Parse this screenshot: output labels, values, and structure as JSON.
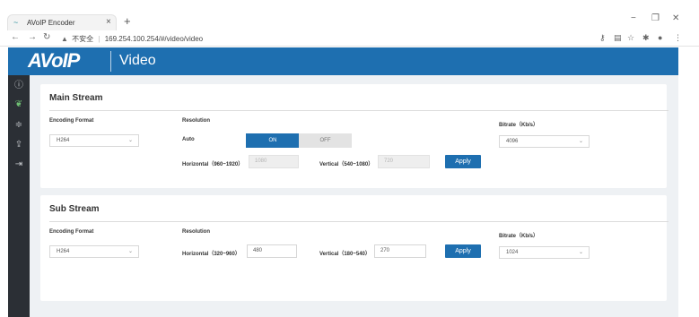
{
  "browser": {
    "tab_title": "AVoIP Encoder",
    "tab_close": "×",
    "new_tab": "+",
    "tab_icon": "~",
    "security_label": "不安全",
    "url": "169.254.100.254/#/video/video",
    "win_minimize": "−",
    "win_restore": "❐",
    "win_close": "✕"
  },
  "app": {
    "logo": "AVoIP",
    "page_title": "Video",
    "accent_color": "#1e6fb0"
  },
  "sidenav": {
    "items": [
      {
        "icon": "info-icon",
        "glyph": "ⓘ"
      },
      {
        "icon": "leaf-icon",
        "glyph": "❦",
        "active": true
      },
      {
        "icon": "sliders-icon",
        "glyph": "≑"
      },
      {
        "icon": "upload-icon",
        "glyph": "⇪"
      },
      {
        "icon": "logout-icon",
        "glyph": "⇥"
      }
    ]
  },
  "main_stream": {
    "title": "Main Stream",
    "encoding_format_label": "Encoding Format",
    "encoding_format_value": "H264",
    "resolution_label": "Resolution",
    "auto_label": "Auto",
    "toggle_on": "ON",
    "toggle_off": "OFF",
    "horizontal_label": "Horizontal（960~1920）",
    "horizontal_value": "1080",
    "vertical_label": "Vertical（540~1080）",
    "vertical_value": "720",
    "apply_label": "Apply",
    "bitrate_label": "Bitrate（Kb/s）",
    "bitrate_value": "4096"
  },
  "sub_stream": {
    "title": "Sub Stream",
    "encoding_format_label": "Encoding Format",
    "encoding_format_value": "H264",
    "resolution_label": "Resolution",
    "horizontal_label": "Horizontal（320~960）",
    "horizontal_value": "480",
    "vertical_label": "Vertical（180~540）",
    "vertical_value": "270",
    "apply_label": "Apply",
    "bitrate_label": "Bitrate（Kb/s）",
    "bitrate_value": "1024"
  }
}
